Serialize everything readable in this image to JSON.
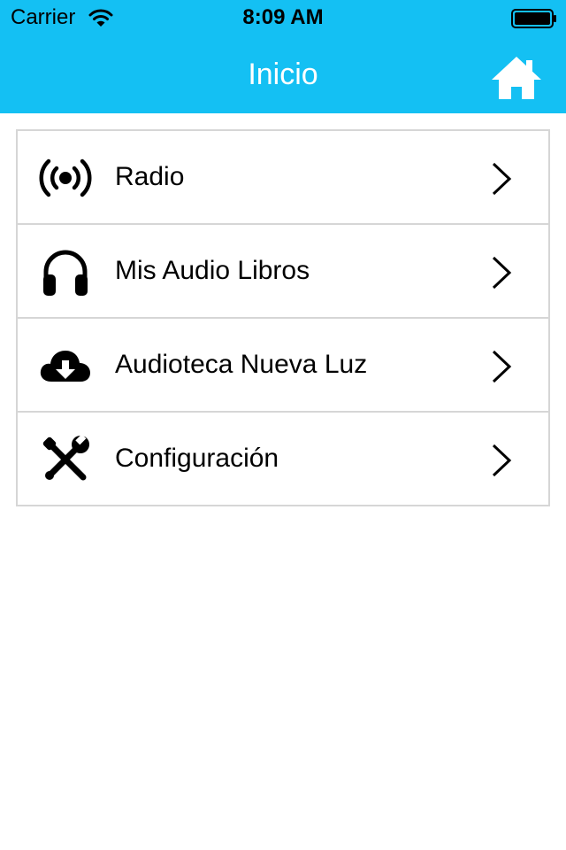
{
  "status_bar": {
    "carrier": "Carrier",
    "time": "8:09 AM",
    "icons": [
      "wifi-icon",
      "battery-icon"
    ]
  },
  "nav_bar": {
    "title": "Inicio",
    "background_color": "#14c0f3",
    "right_button_icon": "home-icon"
  },
  "menu": {
    "items": [
      {
        "label": "Radio",
        "icon": "broadcast-icon"
      },
      {
        "label": "Mis Audio Libros",
        "icon": "headphones-icon"
      },
      {
        "label": "Audioteca Nueva Luz",
        "icon": "cloud-download-icon"
      },
      {
        "label": "Configuración",
        "icon": "tools-icon"
      }
    ]
  }
}
